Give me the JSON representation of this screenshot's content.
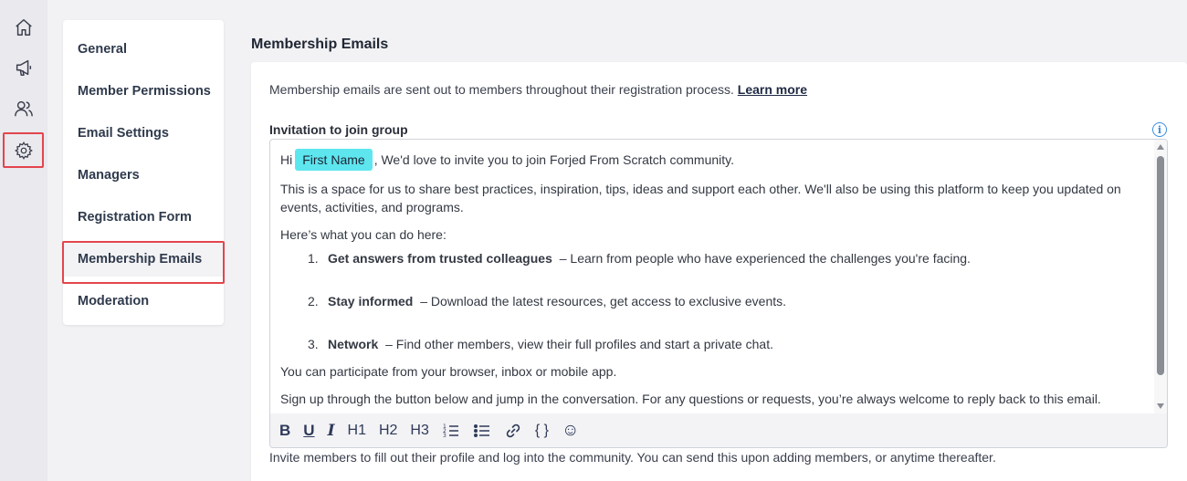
{
  "rail": {
    "icons": [
      "home-icon",
      "megaphone-icon",
      "people-icon",
      "gear-icon"
    ],
    "active": "gear-icon"
  },
  "nav": {
    "items": [
      {
        "label": "General"
      },
      {
        "label": "Member Permissions"
      },
      {
        "label": "Email Settings"
      },
      {
        "label": "Managers"
      },
      {
        "label": "Registration Form"
      },
      {
        "label": "Membership Emails"
      },
      {
        "label": "Moderation"
      }
    ],
    "active_index": 5
  },
  "main": {
    "title": "Membership Emails",
    "intro_text": "Membership emails are sent out to members throughout their registration process.",
    "learn_more": "Learn more",
    "field_label": "Invitation to join group",
    "info_icon": "i",
    "editor": {
      "greeting": "Hi",
      "chip": "First Name",
      "line1_rest": ", We'd love to invite you to join Forjed From Scratch community.",
      "para2": "This is a space for us to share best practices, inspiration, tips, ideas and support each other. We'll also be using this platform to keep you updated on events, activities, and programs.",
      "para3": "Here’s what you can do here:",
      "list": [
        {
          "num": "1.",
          "bold": "Get answers from trusted colleagues",
          "rest": "– Learn from people who have experienced the challenges you're facing."
        },
        {
          "num": "2.",
          "bold": "Stay informed",
          "rest": "– Download the latest resources, get access to exclusive events."
        },
        {
          "num": "3.",
          "bold": "Network",
          "rest": "– Find other members, view their full profiles and start a private chat."
        }
      ],
      "para4": "You can participate from your browser, inbox or mobile app.",
      "para5": "Sign up through the button below and jump in the conversation. For any questions or requests, you’re always welcome to reply back to this email."
    },
    "toolbar": {
      "bold": "B",
      "underline": "U",
      "italic": "I",
      "h1": "H1",
      "h2": "H2",
      "h3": "H3",
      "braces": "{ }",
      "emoji": "☺"
    },
    "helper_text": "Invite members to fill out their profile and log into the community. You can send this upon adding members, or anytime thereafter."
  }
}
